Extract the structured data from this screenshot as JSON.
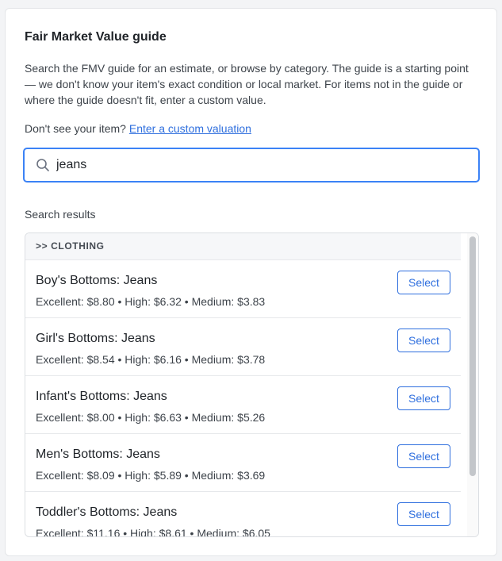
{
  "panel": {
    "title": "Fair Market Value guide",
    "description": "Search the FMV guide for an estimate, or browse by category. The guide is a starting point — we don't know your item's exact condition or local market. For items not in the guide or where the guide doesn't fit, enter a custom value.",
    "custom_prompt": "Don't see your item?",
    "custom_link": "Enter a custom valuation"
  },
  "search": {
    "value": "jeans",
    "icon": "search-icon"
  },
  "results": {
    "label": "Search results",
    "category": ">> CLOTHING",
    "select_label": "Select",
    "items": [
      {
        "name": "Boy's Bottoms: Jeans",
        "prices": "Excellent: $8.80 • High: $6.32 • Medium: $3.83"
      },
      {
        "name": "Girl's Bottoms: Jeans",
        "prices": "Excellent: $8.54 • High: $6.16 • Medium: $3.78"
      },
      {
        "name": "Infant's Bottoms: Jeans",
        "prices": "Excellent: $8.00 • High: $6.63 • Medium: $5.26"
      },
      {
        "name": "Men's Bottoms: Jeans",
        "prices": "Excellent: $8.09 • High: $5.89 • Medium: $3.69"
      },
      {
        "name": "Toddler's Bottoms: Jeans",
        "prices": "Excellent: $11.16 • High: $8.61 • Medium: $6.05"
      }
    ]
  },
  "colors": {
    "accent": "#2f6fde",
    "focus_border": "#3b82f6"
  }
}
